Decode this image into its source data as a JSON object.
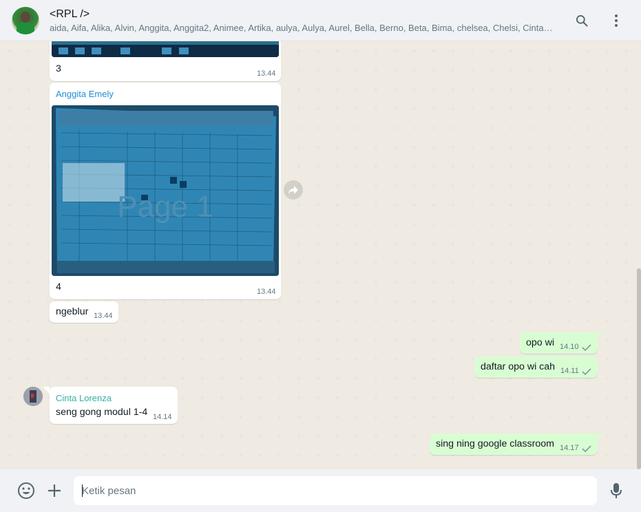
{
  "header": {
    "title": "<RPL />",
    "members": "aida, Aifa, Alika, Alvin, Anggita, Anggita2, Animee, Artika, aulya, Aulya, Aurel, Bella, Berno, Beta, Bima, chelsea, Chelsi, Cinta…"
  },
  "messages": [
    {
      "id": "m1",
      "direction": "in",
      "caption": "3",
      "time": "13.44"
    },
    {
      "id": "m2",
      "direction": "in",
      "sender": "Anggita Emely",
      "sender_color": "#1f8fd6",
      "image_text": "Page 1",
      "caption": "4",
      "time": "13.44"
    },
    {
      "id": "m3",
      "direction": "in",
      "text": "ngeblur",
      "time": "13.44"
    },
    {
      "id": "m4",
      "direction": "out",
      "text": "opo wi",
      "time": "14.10"
    },
    {
      "id": "m5",
      "direction": "out",
      "text": "daftar opo wi cah",
      "time": "14.11"
    },
    {
      "id": "m6",
      "direction": "in",
      "sender": "Cinta Lorenza",
      "sender_color": "#35b0a6",
      "text": "seng gong modul 1-4",
      "time": "14.14"
    },
    {
      "id": "m7",
      "direction": "out",
      "text": "sing ning google classroom",
      "time": "14.17"
    }
  ],
  "composer": {
    "placeholder": "Ketik pesan"
  },
  "icons": {
    "search": "search-icon",
    "menu": "menu-dots-icon",
    "emoji": "emoji-icon",
    "attach": "plus-icon",
    "mic": "microphone-icon",
    "forward": "forward-icon",
    "tick": "check-icon"
  },
  "colors": {
    "outgoing_bubble": "#d9fdd3",
    "incoming_bubble": "#ffffff",
    "chat_background": "#efeae2"
  }
}
